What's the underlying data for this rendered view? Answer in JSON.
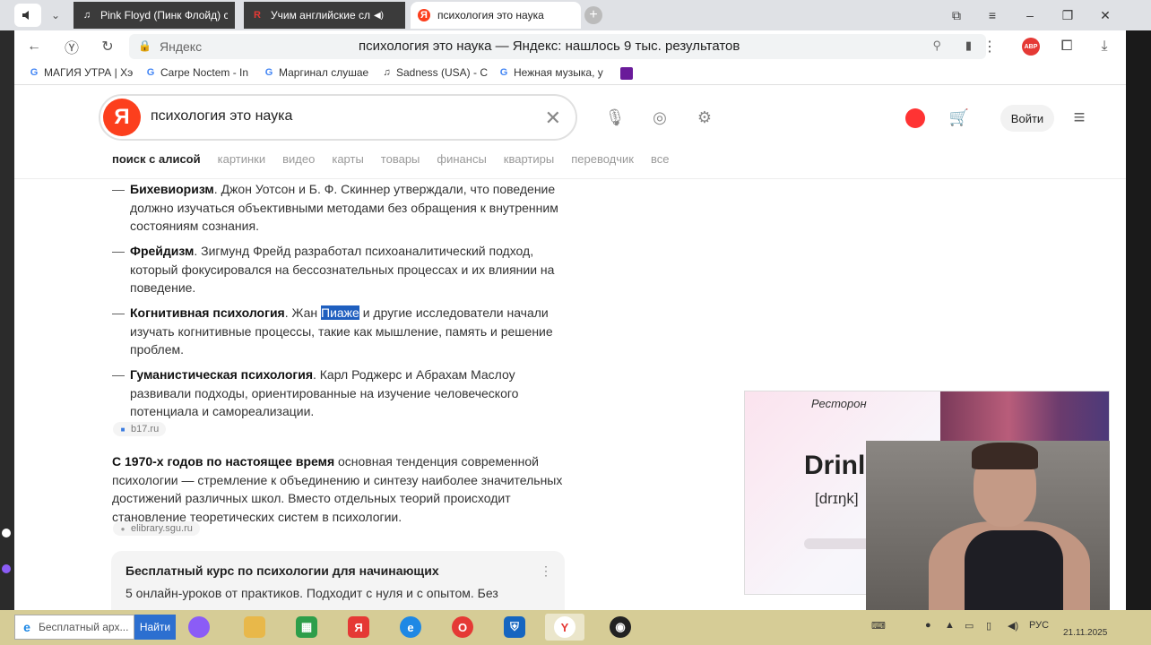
{
  "browser": {
    "tabs": [
      {
        "icon": "music-note-icon",
        "label": "Pink Floyd (Пинк Флойд) с"
      },
      {
        "icon": "r-logo-icon",
        "label": "Учим английские сл"
      },
      {
        "icon": "yandex-icon",
        "label": "психология это наука"
      }
    ],
    "address": {
      "host": "Яндекс",
      "title": "психология это наука — Яндекс: нашлось 9 тыс. результатов"
    },
    "extension_badge": "АВР",
    "bookmarks": [
      {
        "icon": "google-icon",
        "label": "МАГИЯ УТРА | Хэ"
      },
      {
        "icon": "google-icon",
        "label": "Carpe Noctem - In"
      },
      {
        "icon": "google-icon",
        "label": "Маргинал слушае"
      },
      {
        "icon": "music-note-icon",
        "label": "Sadness (USA) - C"
      },
      {
        "icon": "google-icon",
        "label": "Нежная музыка, у"
      }
    ]
  },
  "search": {
    "logo": "Я",
    "query": "психология это наука",
    "login": "Войти",
    "tabs": [
      "поиск с алисой",
      "картинки",
      "видео",
      "карты",
      "товары",
      "финансы",
      "квартиры",
      "переводчик",
      "все"
    ]
  },
  "answer": {
    "items": [
      {
        "term": "Бихевиоризм",
        "text": ". Джон Уотсон и Б. Ф. Скиннер утверждали, что поведение должно изучаться объективными методами без обращения к внутренним состояниям сознания."
      },
      {
        "term": "Фрейдизм",
        "text": ". Зигмунд Фрейд разработал психоаналитический подход, который фокусировался на бессознательных процессах и их влиянии на поведение."
      },
      {
        "term": "Когнитивная психология",
        "pre": ". Жан ",
        "highlight": "Пиаже",
        "text": " и другие исследователи начали изучать когнитивные процессы, такие как мышление, память и решение проблем."
      },
      {
        "term": "Гуманистическая психология",
        "text": ". Карл Роджерс и Абрахам Маслоу развивали подходы, ориентированные на изучение человеческого потенциала и самореализации."
      }
    ],
    "source1": "b17.ru",
    "para_bold": "С 1970-х годов по настоящее время",
    "para_text": " основная тенденция современной психологии — стремление к объединению и синтезу наиболее значительных достижений различных школ. Вместо отдельных теорий происходит становление теоретических систем в психологии.",
    "source2": "elibrary.sgu.ru",
    "ad_title": "Бесплатный курс по психологии для начинающих",
    "ad_desc": "5 онлайн-уроков от практиков. Подходит с нуля и с опытом. Без"
  },
  "overlay": {
    "label": "Ресторон",
    "word": "Drinl",
    "ipa": "[drɪŋk]"
  },
  "taskbar": {
    "search_text": "Бесплатный арх...",
    "find_button": "Найти",
    "lang": "РУС",
    "date": "21.11.2025"
  },
  "colors": {
    "yandex_red": "#fc3f1d",
    "highlight": "#1f5fbf",
    "taskbar": "#d6cc96"
  }
}
